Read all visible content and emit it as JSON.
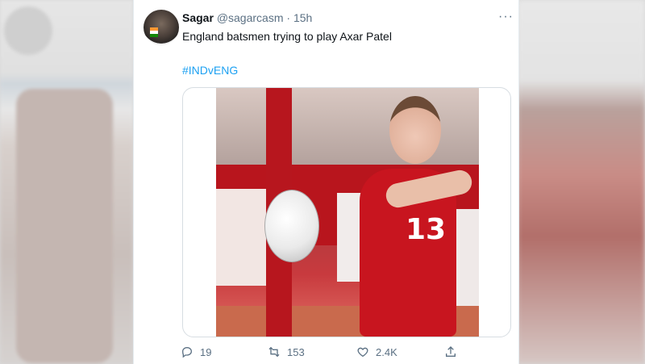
{
  "tweet": {
    "author_name": "Sagar",
    "handle": "@sagarcasm",
    "separator": "·",
    "time": "15h",
    "more_label": "···",
    "text": "England batsmen trying to play Axar Patel",
    "hashtag": "#INDvENG",
    "image_jersey_number": "13"
  },
  "actions": {
    "reply_count": "19",
    "retweet_count": "153",
    "like_count": "2.4K"
  },
  "icons": {
    "reply": "reply-icon",
    "retweet": "retweet-icon",
    "like": "heart-icon",
    "share": "share-icon",
    "more": "more-icon"
  },
  "colors": {
    "link": "#1da1f2",
    "muted": "#5b7083",
    "text": "#0f1419"
  }
}
